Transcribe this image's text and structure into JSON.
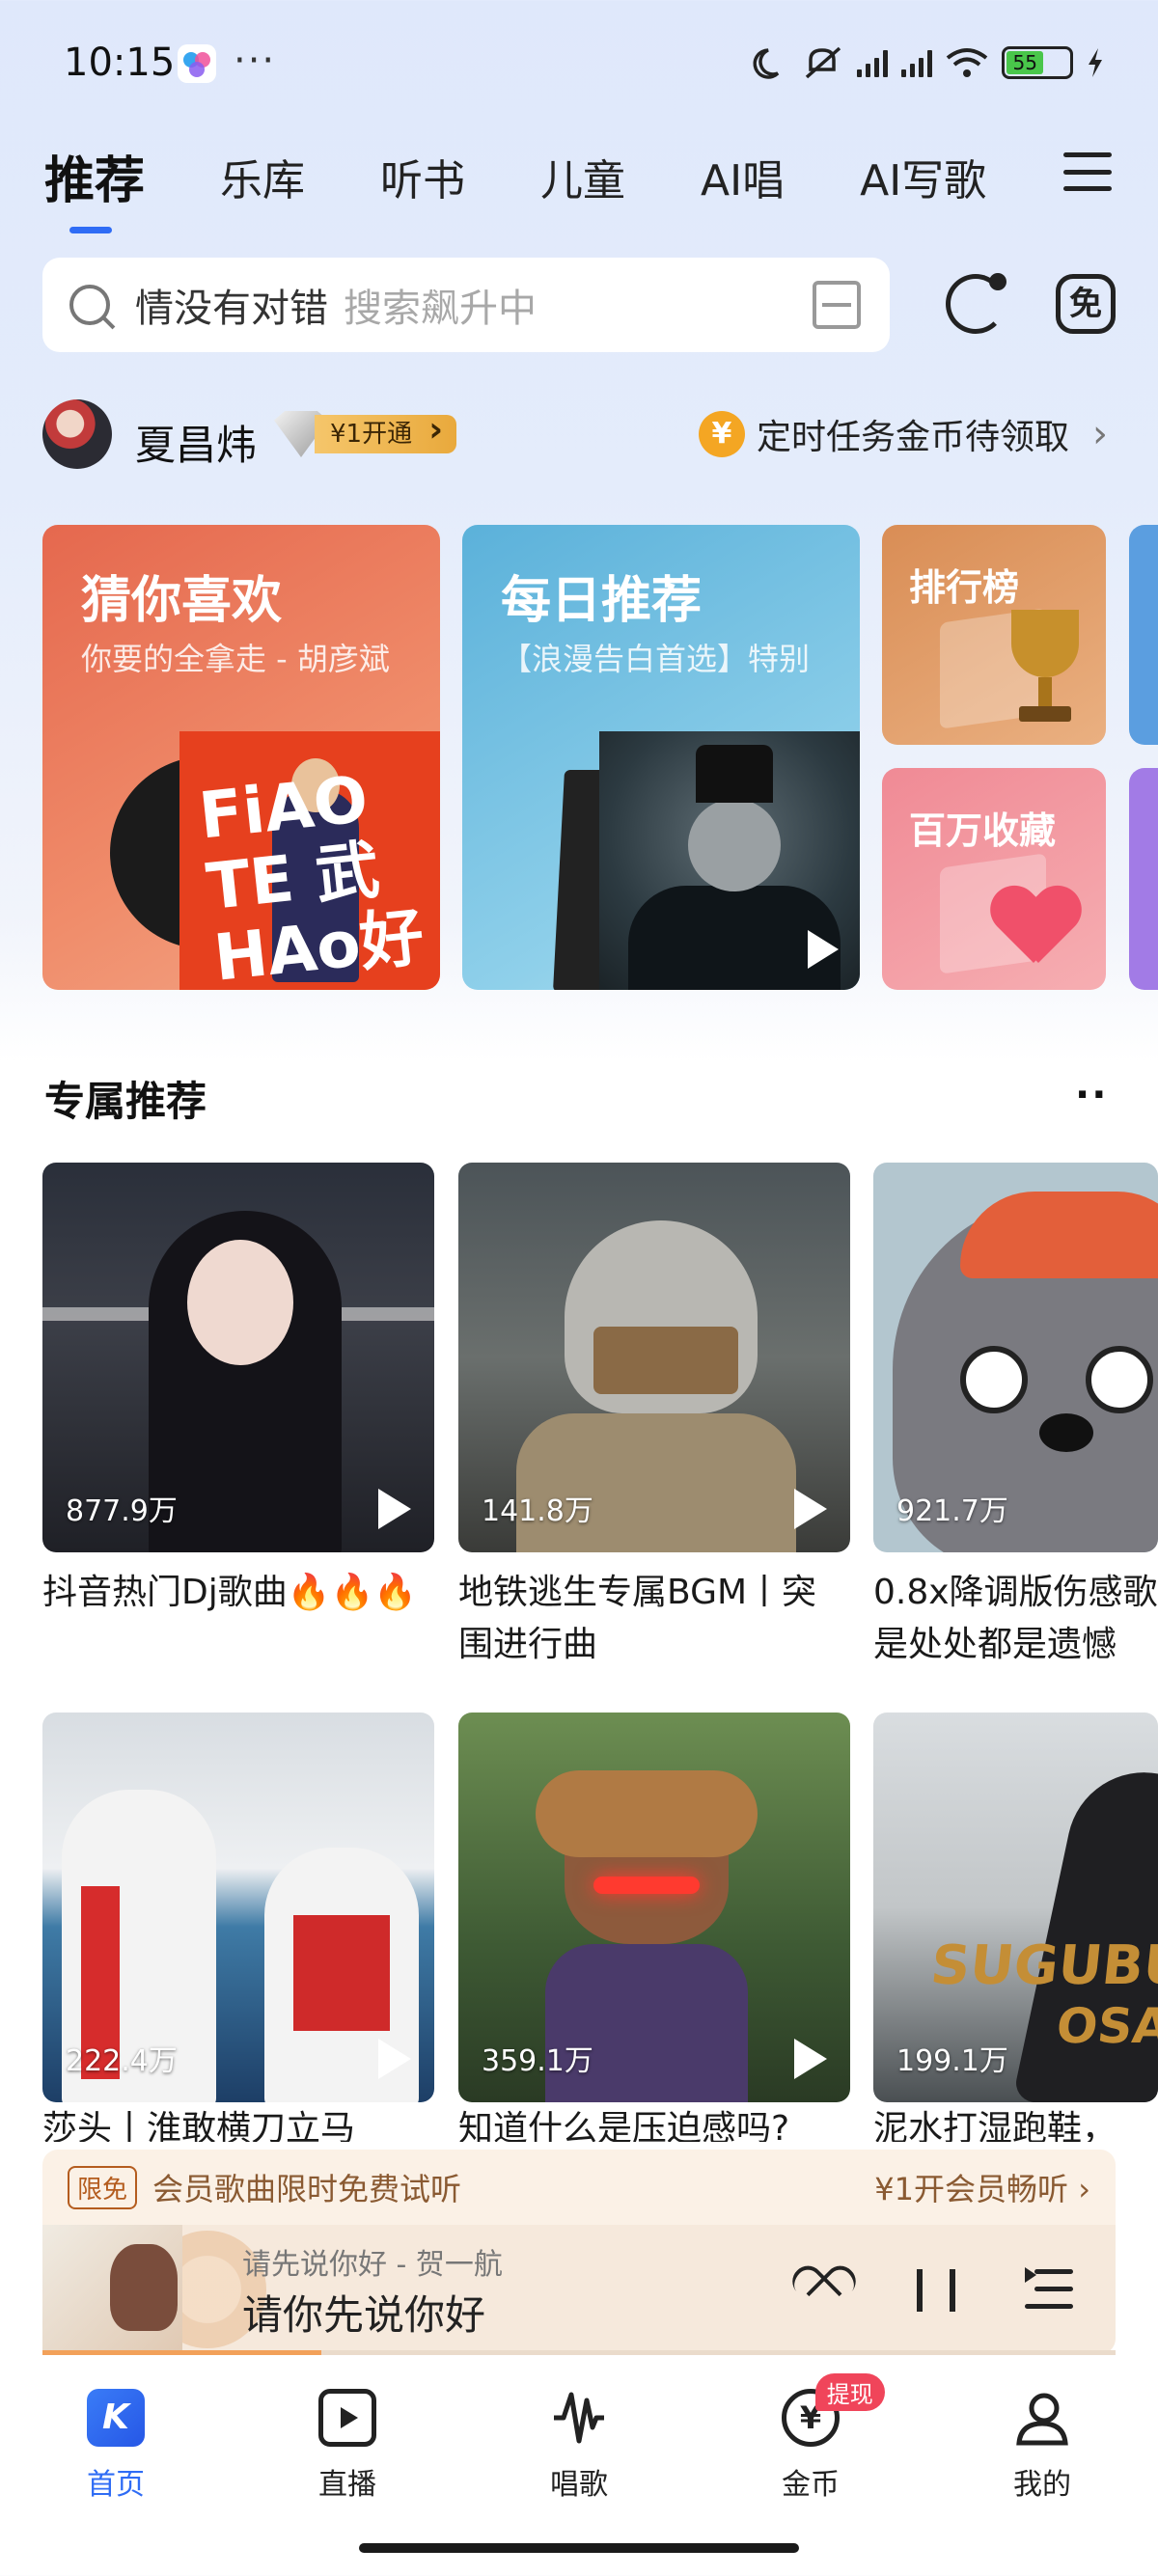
{
  "status_bar": {
    "time": "10:15",
    "more": "···",
    "battery": "55"
  },
  "top_tabs": [
    "推荐",
    "乐库",
    "听书",
    "儿童",
    "AI唱",
    "AI写歌"
  ],
  "search": {
    "hot_word": "情没有对错",
    "placeholder": "搜索飙升中"
  },
  "user": {
    "name": "夏昌炜",
    "vip_label": "¥1开通",
    "task_label": "定时任务金币待领取",
    "coin_symbol": "¥"
  },
  "feature_cards": {
    "guess": {
      "title": "猜你喜欢",
      "subtitle": "你要的全拿走 - 胡彦斌",
      "cover_text": "FiAO TE HAo 勤武好"
    },
    "daily": {
      "title": "每日推荐",
      "subtitle": "【浪漫告白首选】特别"
    },
    "rank": {
      "title": "排行榜"
    },
    "favorites": {
      "title": "百万收藏"
    }
  },
  "section": {
    "title": "专属推荐",
    "more": "··"
  },
  "playlists": [
    {
      "count": "877.9万",
      "title": "抖音热门Dj歌曲🔥🔥🔥"
    },
    {
      "count": "141.8万",
      "title": "地铁逃生专属BGM丨突围进行曲"
    },
    {
      "count": "921.7万",
      "title": "0.8x降调版伤感歌是处处都是遗憾"
    },
    {
      "count": "222.4万",
      "title": "莎头丨淮敢横刀立马"
    },
    {
      "count": "359.1万",
      "title": "知道什么是压迫感吗?"
    },
    {
      "count": "199.1万",
      "title": "泥水打湿跑鞋，"
    }
  ],
  "tile_logo": {
    "line1": "SUGUBU",
    "line2": "OSA"
  },
  "member_bar": {
    "tag": "限免",
    "text": "会员歌曲限时免费试听",
    "cta": "¥1开会员畅听 ›"
  },
  "player": {
    "subtitle": "请先说你好  -  贺一航",
    "title": "请你先说你好",
    "progress": 0.26
  },
  "bottom_nav": [
    {
      "label": "首页",
      "icon": "K"
    },
    {
      "label": "直播"
    },
    {
      "label": "唱歌"
    },
    {
      "label": "金币",
      "badge": "提现",
      "icon": "¥"
    },
    {
      "label": "我的"
    }
  ],
  "colors": {
    "accent": "#2f6cf5",
    "guess_card": "#e5684e",
    "daily_card": "#5bb1da"
  }
}
